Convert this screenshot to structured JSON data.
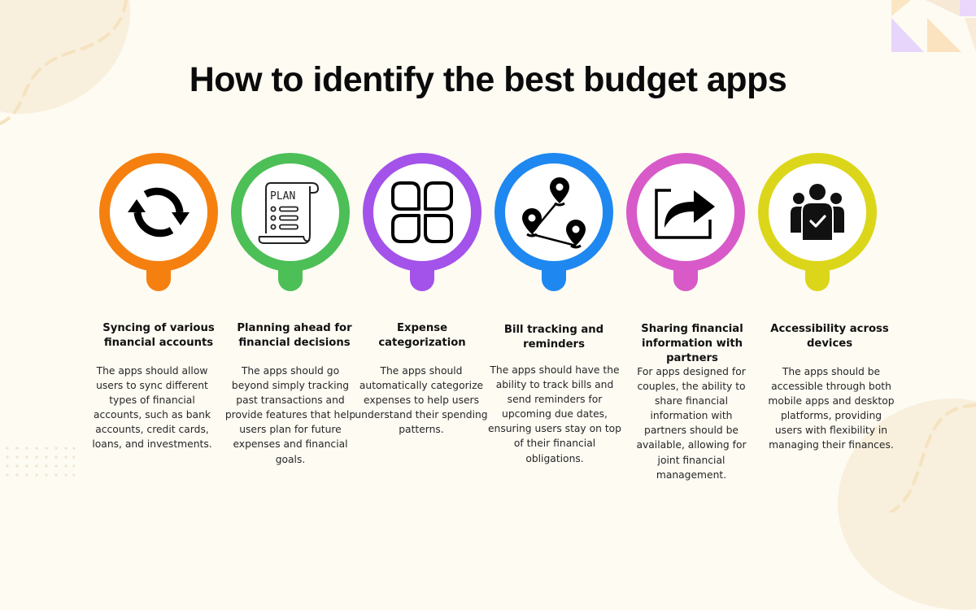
{
  "title": "How to identify the best budget apps",
  "colors": {
    "background": "#fefbf3",
    "orange": "#f5800f",
    "green": "#4cbf56",
    "purple": "#a352ea",
    "blue": "#1e88f0",
    "magenta": "#d85ac9",
    "yellow": "#dcd61a"
  },
  "items": [
    {
      "icon": "sync-arrows-icon",
      "color": "#f5800f",
      "heading": "Syncing of various financial accounts",
      "description": "The apps should allow users to sync different types of financial accounts, such as bank accounts, credit cards, loans, and investments."
    },
    {
      "icon": "plan-scroll-icon",
      "color": "#4cbf56",
      "icon_text": "PLAN",
      "heading": "Planning ahead for financial decisions",
      "description": "The apps should go beyond simply tracking past transactions and provide features that help users plan for future expenses and financial goals."
    },
    {
      "icon": "category-grid-icon",
      "color": "#a352ea",
      "heading": "Expense categorization",
      "description": "The apps should automatically categorize expenses to help users understand their spending patterns."
    },
    {
      "icon": "route-pins-icon",
      "color": "#1e88f0",
      "heading": "Bill tracking and reminders",
      "description": "The apps should have the ability to track bills and send reminders for upcoming due dates, ensuring users stay on top of their financial obligations."
    },
    {
      "icon": "share-arrow-icon",
      "color": "#d85ac9",
      "heading": "Sharing financial information with partners",
      "description": "For apps designed for couples, the ability to share financial information with partners should be available, allowing for joint financial management."
    },
    {
      "icon": "group-check-icon",
      "color": "#dcd61a",
      "heading": "Accessibility across devices",
      "description": "The apps should be accessible through both mobile apps and desktop platforms, providing users with flexibility in managing their finances."
    }
  ]
}
